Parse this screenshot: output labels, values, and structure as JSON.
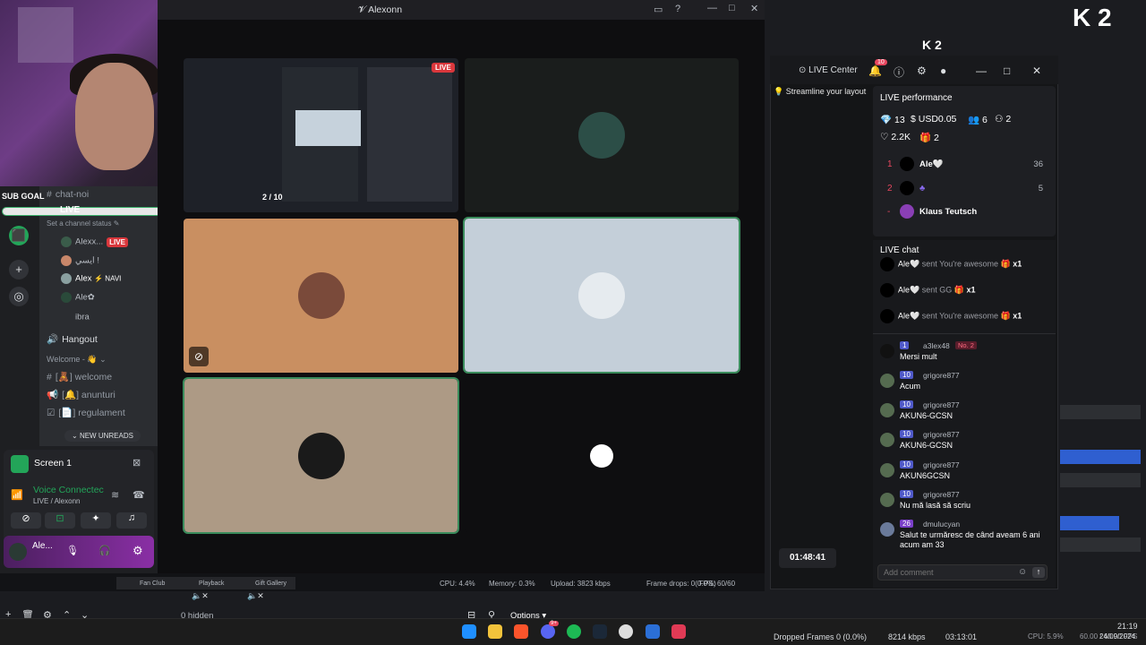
{
  "webcam": {
    "sub_goal": "SUB GOAL",
    "sub_progress": 0.72,
    "live_text": "LIVE"
  },
  "discord": {
    "channels": {
      "chat_noi": "chat-noi",
      "live": "LIVE",
      "status": "Set a channel status",
      "hangout": "Hangout",
      "welcome_cat": "Welcome - 👋",
      "welcome": "welcome",
      "anunturi": "anunturi",
      "regulament": "regulament"
    },
    "voice_users": [
      {
        "name": "Alexx...",
        "badge": "LIVE"
      },
      {
        "name": "ايسي !"
      },
      {
        "name": "Alex",
        "tag": "⚡ NAVI"
      },
      {
        "name": "Ale✿"
      },
      {
        "name": "ibra"
      }
    ],
    "new_unreads": "NEW UNREADS",
    "screen_label": "Screen 1",
    "voice_connected": "Voice Connectec",
    "voice_sub": "LIVE / Alexonn",
    "user_name": "Ale..."
  },
  "stream": {
    "title": "Alexonn",
    "page_indicator": "2 / 10",
    "live_tag": "LIVE"
  },
  "kick": {
    "logo_big": "K 2",
    "logo_small": "K 2"
  },
  "live_center": {
    "title": "LIVE Center",
    "notif_count": "10",
    "tip": "Streamline your layout",
    "performance": {
      "heading": "LIVE performance",
      "diamonds": "13",
      "usd": "USD0.05",
      "viewers": "6",
      "joined": "2",
      "likes": "2.2K",
      "gifts": "2"
    },
    "ranking": [
      {
        "rank": "1",
        "name": "Ale🤍",
        "value": "36"
      },
      {
        "rank": "2",
        "name": "♣",
        "value": "5"
      },
      {
        "rank": "-",
        "name": "Klaus Teutsch",
        "value": ""
      }
    ],
    "chat": {
      "heading": "LIVE chat",
      "gifts": [
        {
          "user": "Ale🤍",
          "action": "sent You're awesome",
          "count": "x1"
        },
        {
          "user": "Ale🤍",
          "action": "sent GG",
          "count": "x1"
        },
        {
          "user": "Ale🤍",
          "action": "sent You're awesome",
          "count": "x1"
        }
      ],
      "messages": [
        {
          "level": "1",
          "user": "a3lex48",
          "extra": "No. 2",
          "text": "Mersi mult"
        },
        {
          "level": "10",
          "user": "grigore877",
          "text": "Acum"
        },
        {
          "level": "10",
          "user": "grigore877",
          "text": "AKUN6-GCSN"
        },
        {
          "level": "10",
          "user": "grigore877",
          "text": "AKUN6-GCSN"
        },
        {
          "level": "10",
          "user": "grigore877",
          "text": "AKUN6GCSN"
        },
        {
          "level": "10",
          "user": "grigore877",
          "text": "Nu mă lasă să scriu"
        },
        {
          "level": "26",
          "user": "dmulucyan",
          "text": "Salut te urmăresc de când aveam 6 ani acum am 33"
        }
      ],
      "comment_placeholder": "Add comment"
    },
    "timer": "01:48:41"
  },
  "obs": {
    "cpu": "CPU: 4.4%",
    "memory": "Memory: 0.3%",
    "upload": "Upload: 3823 kbps",
    "frame_drops": "Frame drops: 0(0.0%)",
    "fps": "FPS: 60/60",
    "hidden": "0 hidden",
    "options": "Options",
    "dropped": "Dropped Frames 0 (0.0%)",
    "bitrate": "8214 kbps",
    "time_live": "03:13:01",
    "cpu2": "CPU: 5.9%",
    "fps2": "60.00 / 60.00 FPS",
    "tabs": [
      "Fan Club",
      "Playback",
      "Gift Gallery"
    ]
  },
  "taskbar": {
    "clock": "21:19",
    "date": "24/09/2024",
    "discord_badge": "9+"
  }
}
